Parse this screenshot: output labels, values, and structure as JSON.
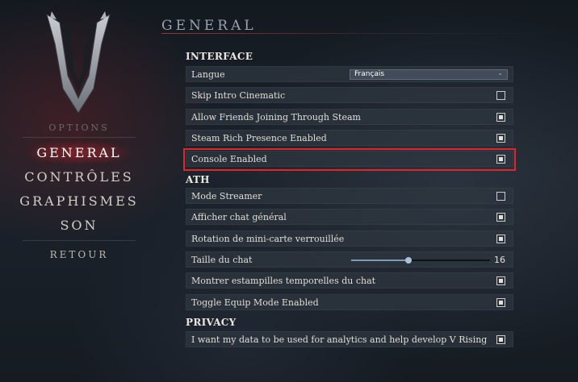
{
  "menu": {
    "options_label": "OPTIONS",
    "items": [
      {
        "label": "GENERAL",
        "active": true
      },
      {
        "label": "CONTRÔLES",
        "active": false
      },
      {
        "label": "GRAPHISMES",
        "active": false
      },
      {
        "label": "SON",
        "active": false
      }
    ],
    "back_label": "RETOUR"
  },
  "header": {
    "title": "GENERAL"
  },
  "groups": {
    "interface": {
      "title": "INTERFACE",
      "language_label": "Langue",
      "language_value": "Français",
      "skip_intro": {
        "label": "Skip Intro Cinematic",
        "checked": false
      },
      "allow_friends": {
        "label": "Allow Friends Joining Through Steam",
        "checked": true
      },
      "rich_presence": {
        "label": "Steam Rich Presence Enabled",
        "checked": true
      },
      "console": {
        "label": "Console Enabled",
        "checked": true
      }
    },
    "hud": {
      "title": "ATH",
      "streamer": {
        "label": "Mode Streamer",
        "checked": false
      },
      "global_chat": {
        "label": "Afficher chat général",
        "checked": true
      },
      "minimap_lock": {
        "label": "Rotation de mini-carte verrouillée",
        "checked": true
      },
      "chat_size": {
        "label": "Taille du chat",
        "value": "16",
        "fraction": 0.41
      },
      "chat_timestamps": {
        "label": "Montrer estampilles temporelles du chat",
        "checked": true
      },
      "equip_mode": {
        "label": "Toggle Equip Mode Enabled",
        "checked": true
      }
    },
    "privacy": {
      "title": "PRIVACY",
      "analytics": {
        "label": "I want my data to be used for analytics and help develop V Rising",
        "checked": true
      }
    }
  },
  "colors": {
    "accent": "#e02626",
    "panel": "#2e3640",
    "slider": "#7d9bb8"
  }
}
